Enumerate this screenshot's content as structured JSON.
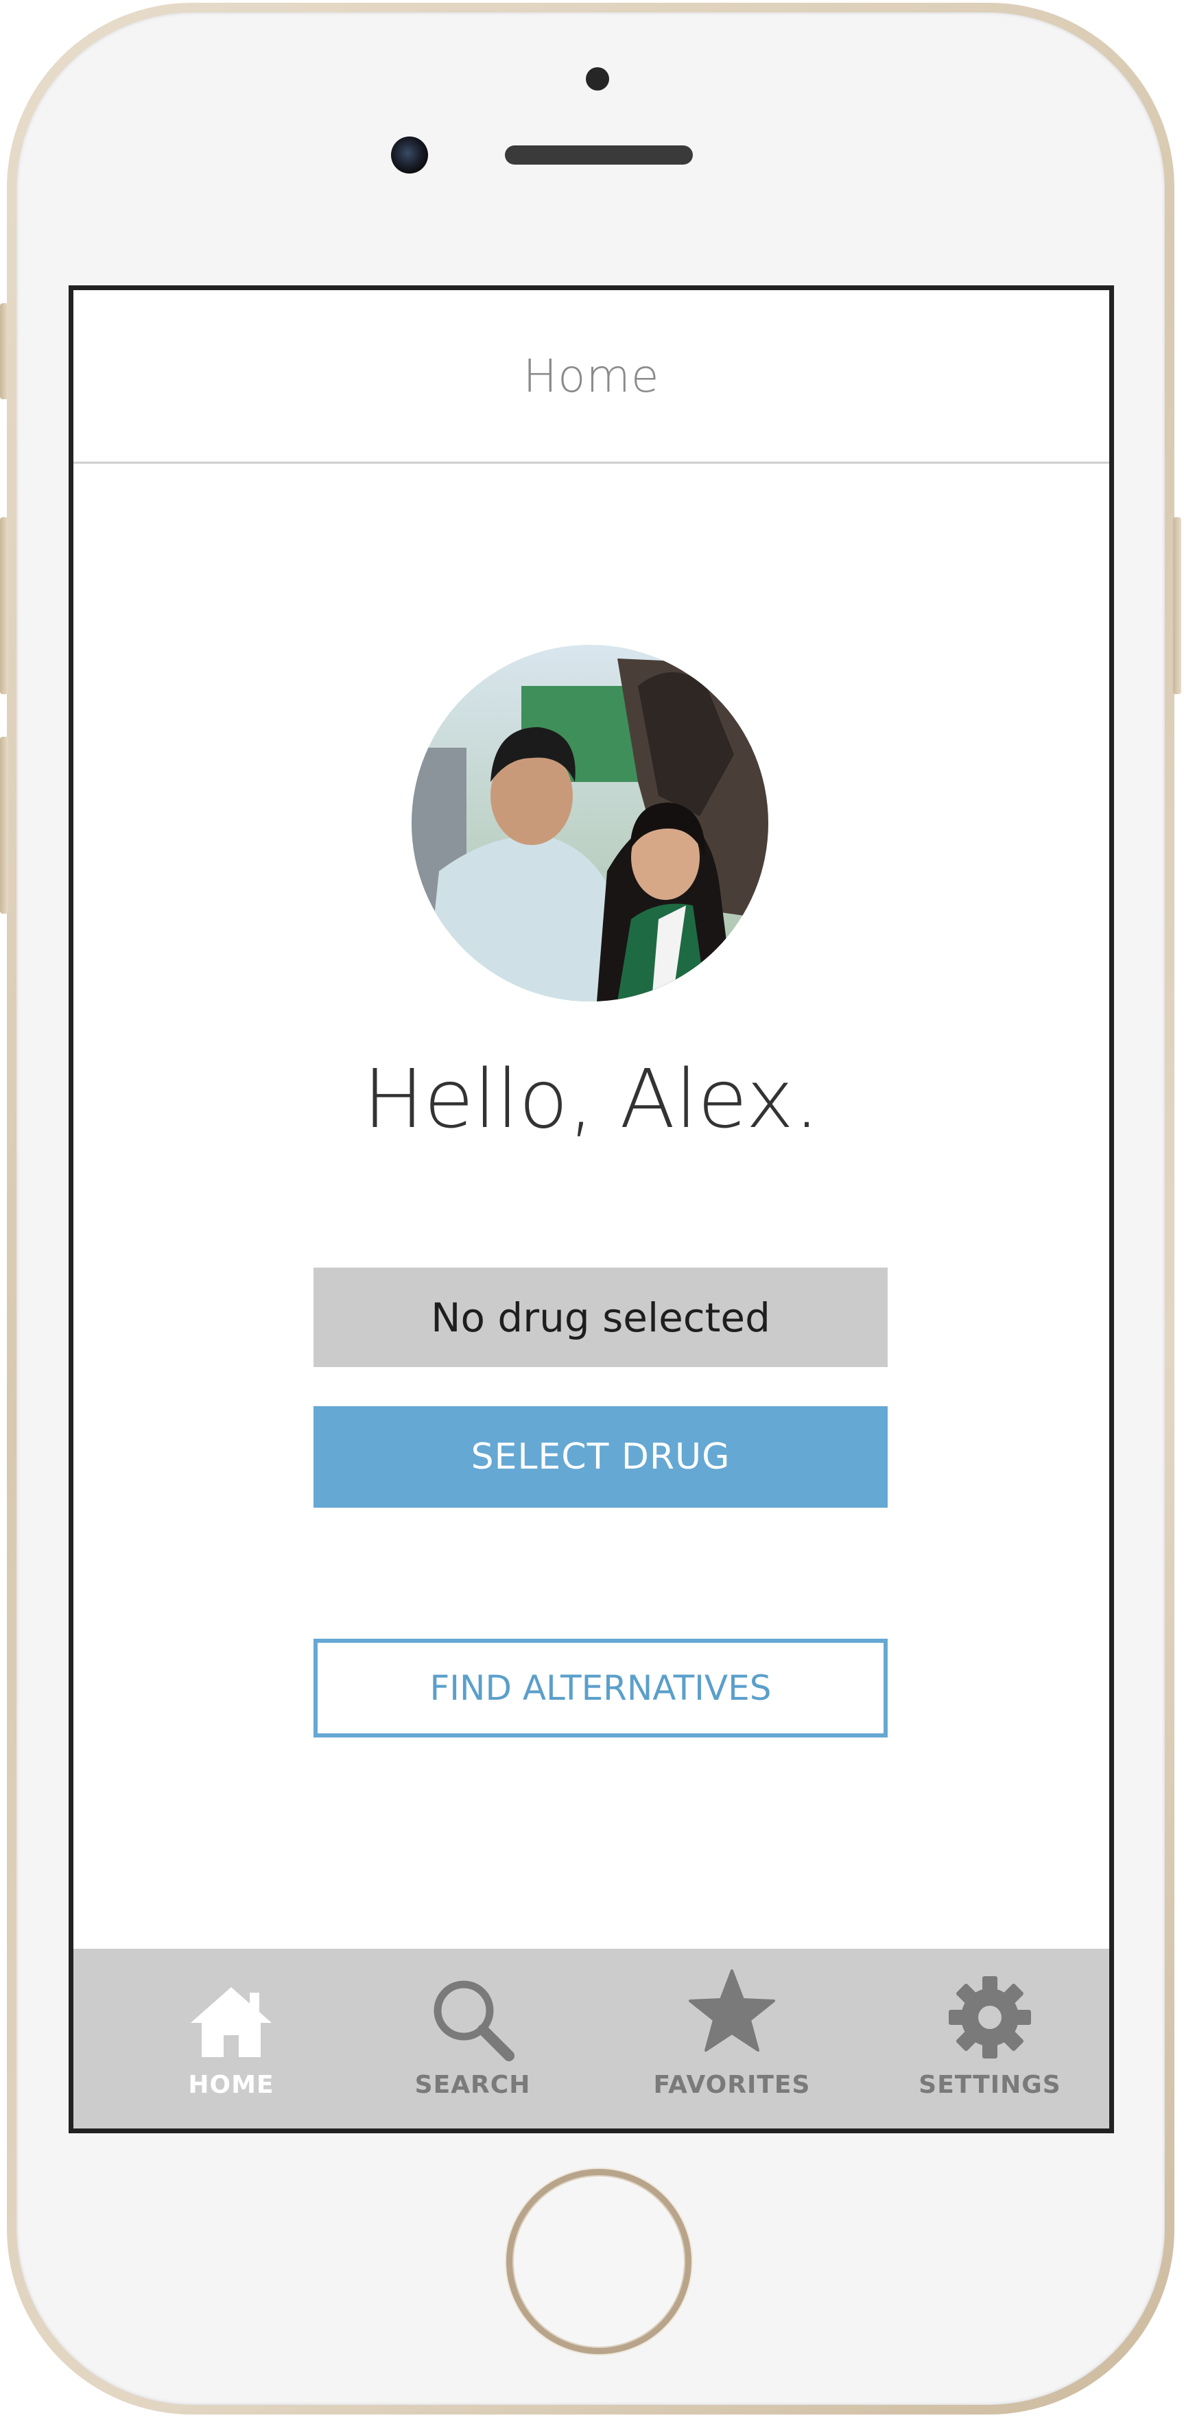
{
  "header": {
    "title": "Home"
  },
  "profile": {
    "greeting": "Hello, Alex.",
    "avatar_alt": "Profile photo"
  },
  "drug": {
    "status": "No drug selected",
    "select_label": "SELECT DRUG",
    "alternatives_label": "FIND ALTERNATIVES"
  },
  "tabbar": {
    "tabs": [
      {
        "label": "HOME",
        "icon": "home-icon",
        "active": true
      },
      {
        "label": "SEARCH",
        "icon": "search-icon",
        "active": false
      },
      {
        "label": "FAVORITES",
        "icon": "star-icon",
        "active": false
      },
      {
        "label": "SETTINGS",
        "icon": "gear-icon",
        "active": false
      }
    ]
  },
  "colors": {
    "accent": "#65a8d3",
    "status_bg": "#cbcbcb",
    "tabbar_bg": "#cccccc",
    "tab_inactive": "#7a7a7a",
    "tab_active": "#ffffff"
  }
}
